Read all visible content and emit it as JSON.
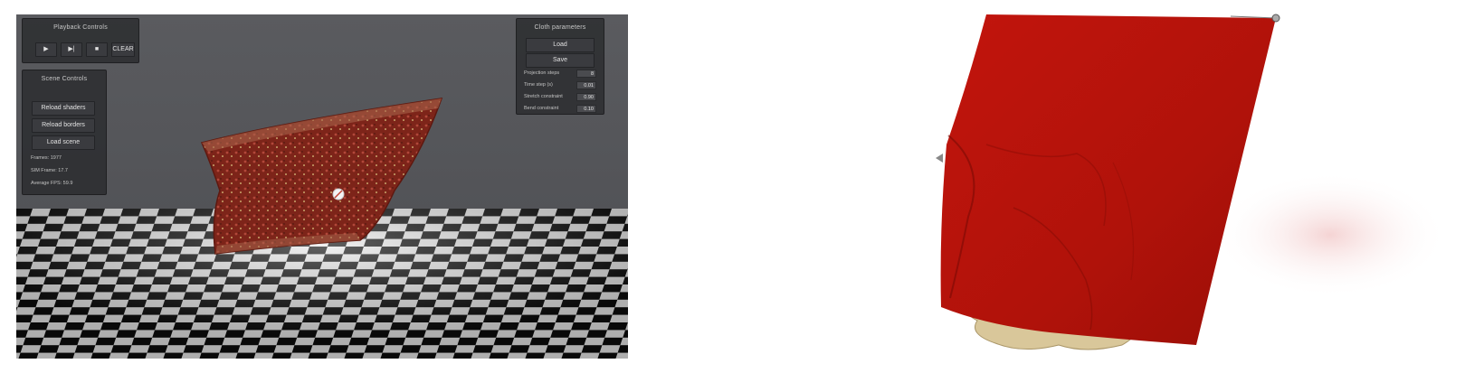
{
  "left_app": {
    "playback": {
      "title": "Playback Controls",
      "buttons": [
        {
          "icon": "play-icon",
          "label": "▶"
        },
        {
          "icon": "step-icon",
          "label": "▶|"
        },
        {
          "icon": "stop-icon",
          "label": "■"
        },
        {
          "icon": "",
          "label": "CLEAR"
        }
      ]
    },
    "scene": {
      "title": "Scene Controls",
      "buttons": [
        "Reload shaders",
        "Reload borders",
        "Load scene"
      ],
      "stats": [
        "Frames: 1977",
        "SIM Frame: 17.7",
        "Average FPS: 59.9"
      ]
    },
    "params": {
      "title": "Cloth parameters",
      "buttons": [
        "Load",
        "Save"
      ],
      "rows": [
        {
          "label": "Projection steps",
          "value": "8"
        },
        {
          "label": "Time step (s)",
          "value": "0.01"
        },
        {
          "label": "Stretch constraint",
          "value": "0.90"
        },
        {
          "label": "Bend constraint",
          "value": "0.10"
        }
      ]
    },
    "colors": {
      "cloth": "#8a2a20",
      "viewport_bg": "#55565a",
      "panel_bg": "#28292c"
    }
  },
  "right_render": {
    "colors": {
      "cloth": "#b3140c",
      "object": "#d9c79a"
    }
  }
}
